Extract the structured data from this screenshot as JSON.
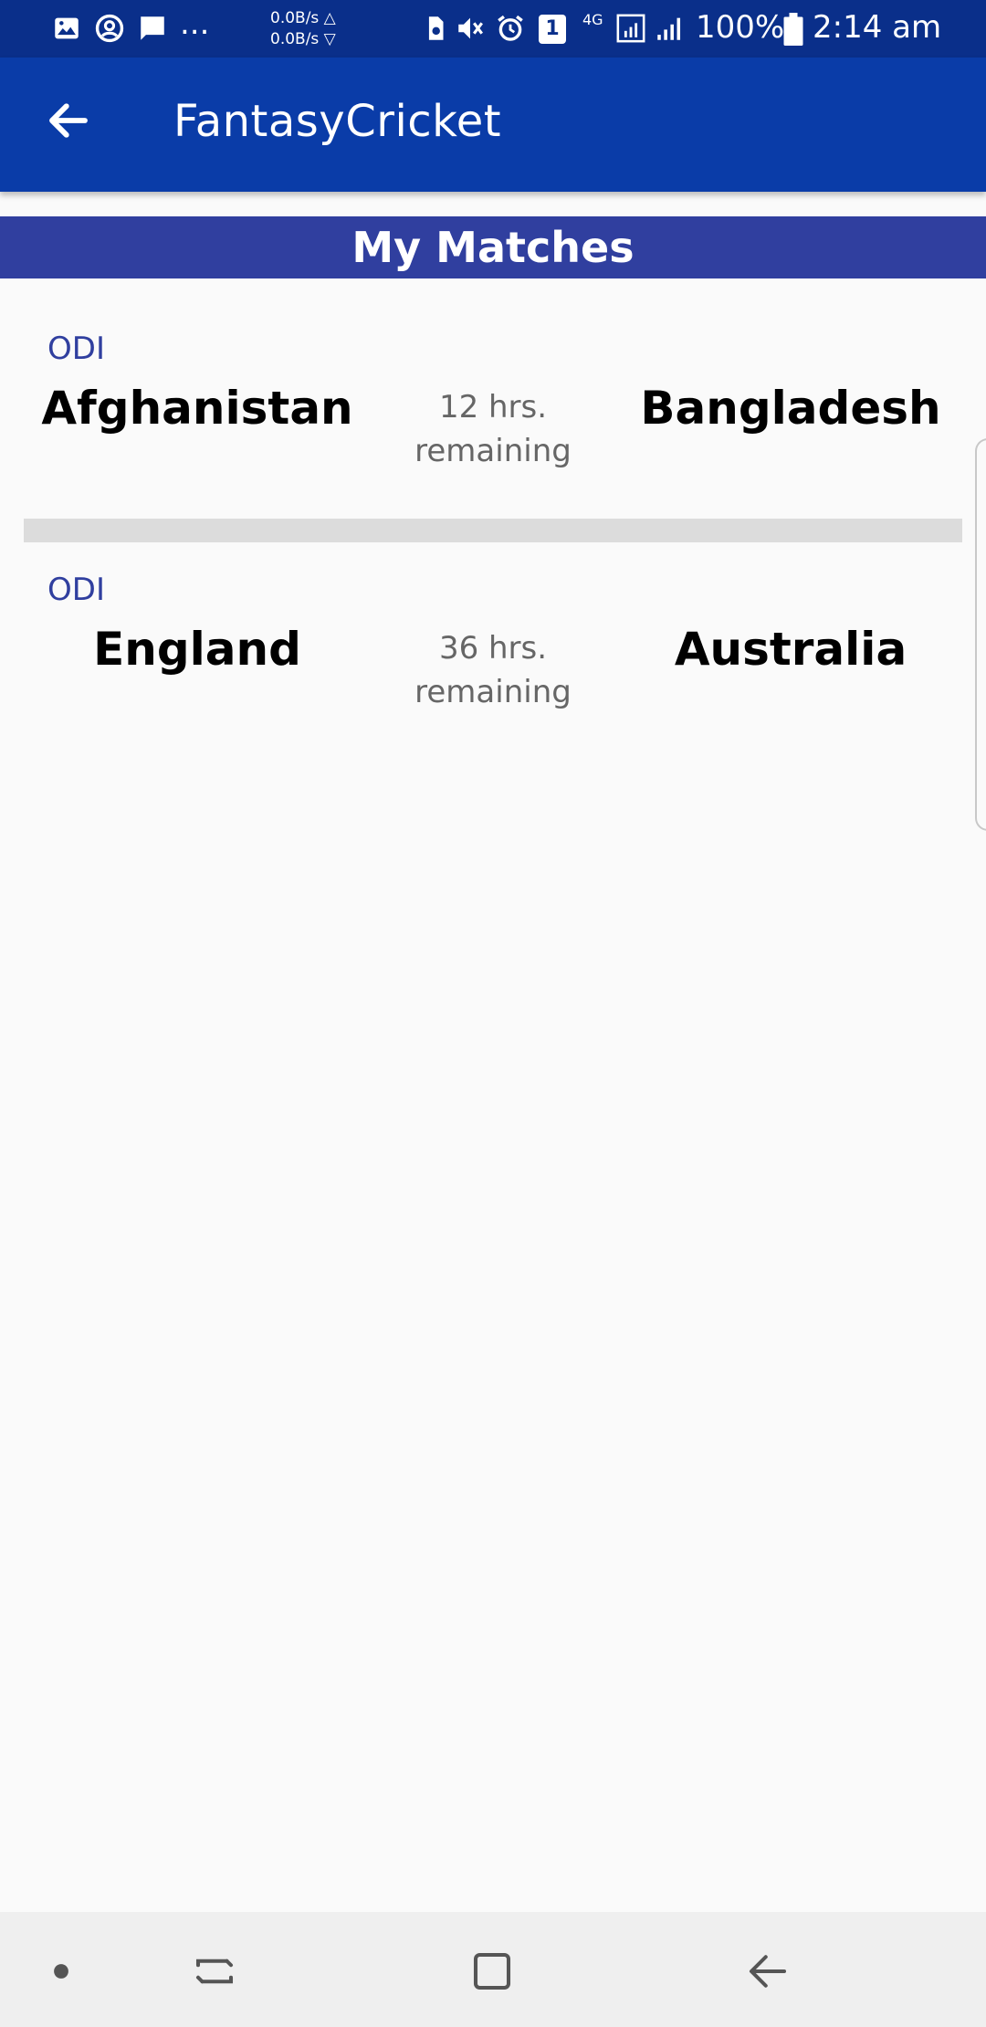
{
  "status_bar": {
    "left_icons": [
      "image-icon",
      "account-circle-icon",
      "message-icon"
    ],
    "overflow": "...",
    "upload_speed": "0.0B/s △",
    "download_speed": "0.0B/s ▽",
    "right_icons": [
      "sim-icon",
      "vibrate-icon",
      "alarm-icon",
      "sim-1-icon",
      "network-4g-icon",
      "signal-r-icon",
      "signal-icon"
    ],
    "network_label": "4G",
    "sim_slot": "1",
    "battery": "100%",
    "time": "2:14 am"
  },
  "app_bar": {
    "title": "FantasyCricket",
    "back_icon": "arrow-back-icon"
  },
  "section": {
    "title": "My Matches"
  },
  "matches": [
    {
      "type": "ODI",
      "team_a": "Afghanistan",
      "team_b": "Bangladesh",
      "time_line1": "12 hrs.",
      "time_line2": "remaining"
    },
    {
      "type": "ODI",
      "team_a": "England",
      "team_b": "Australia",
      "time_line1": "36 hrs.",
      "time_line2": "remaining"
    }
  ],
  "nav_bar": {
    "items": [
      "dot-icon",
      "recents-icon",
      "home-icon",
      "back-icon"
    ]
  },
  "colors": {
    "status_bar": "#0a2f8a",
    "app_bar": "#0a3ca8",
    "section_header": "#303f9f",
    "match_type": "#303f9f",
    "time_text": "#666666"
  }
}
